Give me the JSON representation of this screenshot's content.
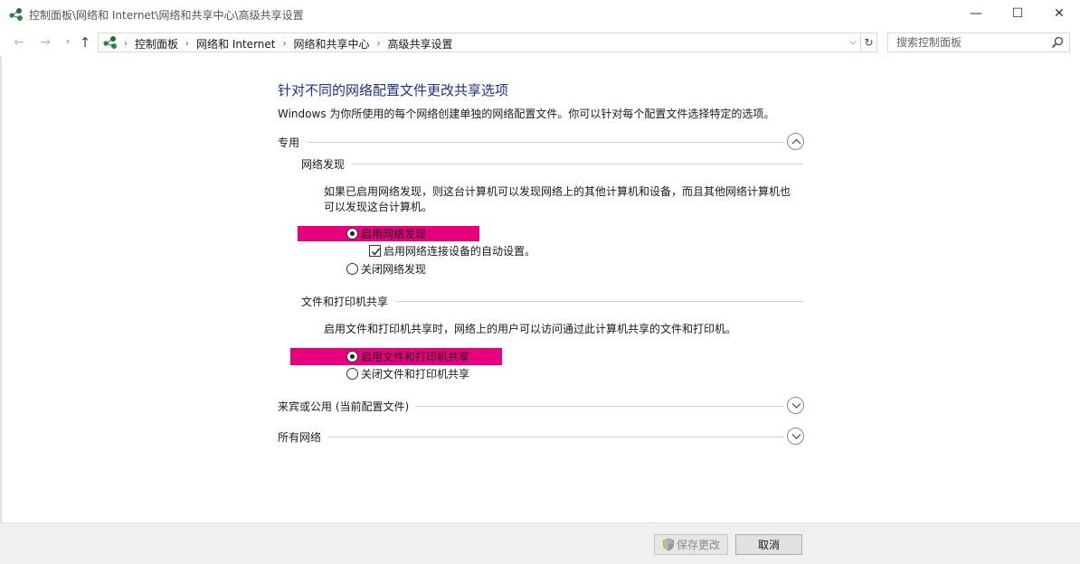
{
  "window": {
    "title": "控制面板\\网络和 Internet\\网络和共享中心\\高级共享设置",
    "minimize": "—",
    "maximize": "☐",
    "close": "✕"
  },
  "nav": {
    "back": "←",
    "forward": "→",
    "recent": "▾",
    "up": "↑",
    "breadcrumbs": [
      "控制面板",
      "网络和 Internet",
      "网络和共享中心",
      "高级共享设置"
    ],
    "refresh": "↻",
    "search_placeholder": "搜索控制面板"
  },
  "main": {
    "title": "针对不同的网络配置文件更改共享选项",
    "description": "Windows 为你所使用的每个网络创建单独的网络配置文件。你可以针对每个配置文件选择特定的选项。",
    "sections": {
      "private": {
        "label": "专用",
        "expanded": true,
        "network_discovery": {
          "label": "网络发现",
          "description": "如果已启用网络发现，则这台计算机可以发现网络上的其他计算机和设备，而且其他网络计算机也可以发现这台计算机。",
          "enable_label": "启用网络发现",
          "auto_setup_label": "启用网络连接设备的自动设置。",
          "disable_label": "关闭网络发现",
          "enabled": true,
          "auto_setup": true
        },
        "file_sharing": {
          "label": "文件和打印机共享",
          "description": "启用文件和打印机共享时，网络上的用户可以访问通过此计算机共享的文件和打印机。",
          "enable_label": "启用文件和打印机共享",
          "disable_label": "关闭文件和打印机共享",
          "enabled": true
        }
      },
      "guest_public": {
        "label": "来宾或公用 (当前配置文件)",
        "expanded": false
      },
      "all_networks": {
        "label": "所有网络",
        "expanded": false
      }
    }
  },
  "footer": {
    "save_label": "保存更改",
    "cancel_label": "取消"
  },
  "colors": {
    "title_blue": "#1e3287",
    "highlight_magenta": "#e6007e"
  }
}
